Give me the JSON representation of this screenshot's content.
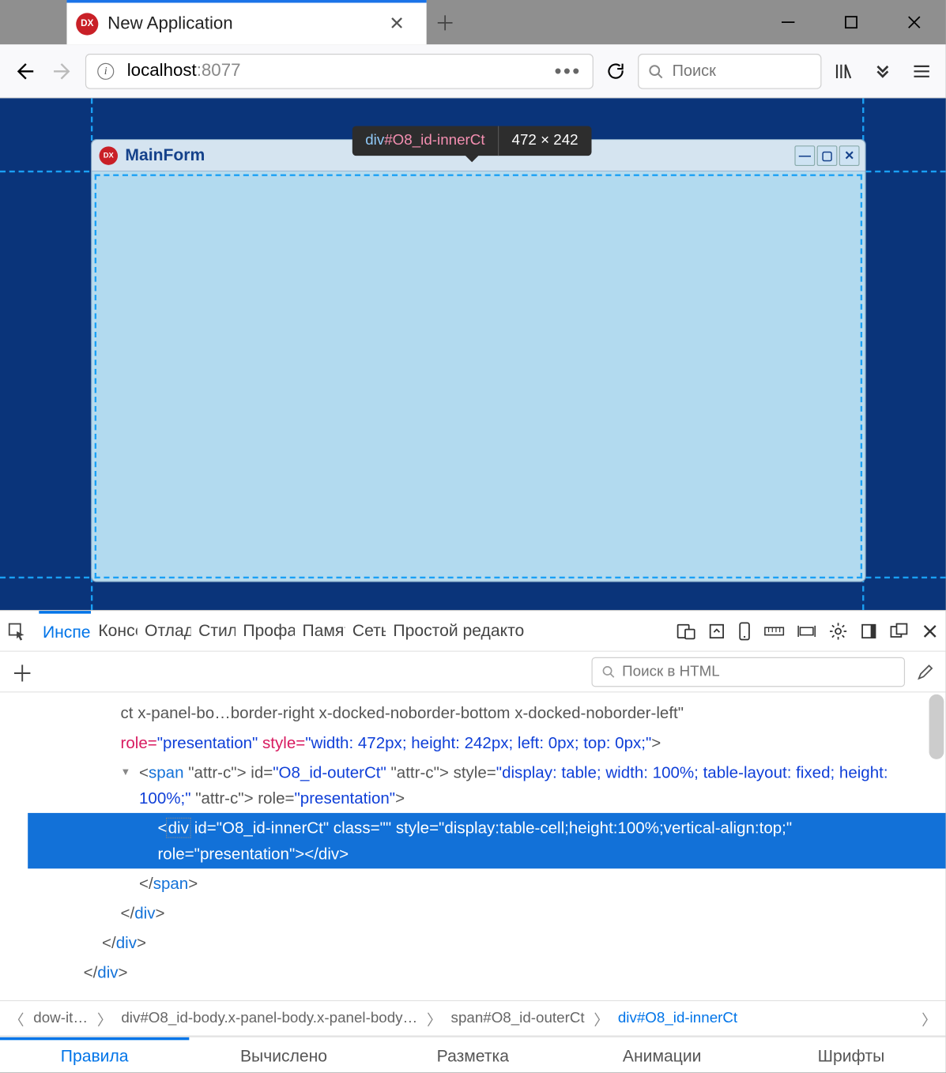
{
  "browser": {
    "tab_title": "New Application",
    "url_host": "localhost",
    "url_port": ":8077",
    "search_placeholder": "Поиск"
  },
  "viewport": {
    "window_title": "MainForm",
    "tooltip_tag": "div",
    "tooltip_id": "#O8_id-innerCt",
    "tooltip_dims": "472 × 242"
  },
  "devtools": {
    "tabs": [
      "Инспектор",
      "Консоль",
      "Отладка",
      "Стили",
      "Профайлер",
      "Память",
      "Сеть",
      "Простой редактор"
    ],
    "active_tab_index": 0,
    "html_search_placeholder": "Поиск в HTML",
    "dom": {
      "line0": "ct x-panel-bo…border-right x-docked-noborder-bottom x-docked-noborder-left\"",
      "line1_attr": "role=",
      "line1_val": "\"presentation\"",
      "line1_attr2": " style=",
      "line1_val2": "\"width: 472px; height: 242px; left: 0px; top: 0px;\"",
      "line1_end": ">",
      "line2_open": "<",
      "line2_tag": "span",
      "line2_attrs": " id=\"O8_id-outerCt\" style=\"display: table; width: 100%; table-layout: fixed; height: 100%;\" role=\"presentation\">",
      "line3_open": "<",
      "line3_tag": "div",
      "line3_rest": " id=\"O8_id-innerCt\" class=\"\" style=\"display:table-cell;height:100%;vertical-align:top;\" role=\"presentation\"></div>",
      "line4": "</span>",
      "line5": "</div>",
      "line6": "</div>",
      "line7": "</div>"
    },
    "crumbs": [
      "dow-it…",
      "div#O8_id-body.x-panel-body.x-panel-body…",
      "span#O8_id-outerCt",
      "div#O8_id-innerCt"
    ],
    "active_crumb_index": 3,
    "style_tabs": [
      "Правила",
      "Вычислено",
      "Разметка",
      "Анимации",
      "Шрифты"
    ],
    "active_style_tab": 0
  }
}
